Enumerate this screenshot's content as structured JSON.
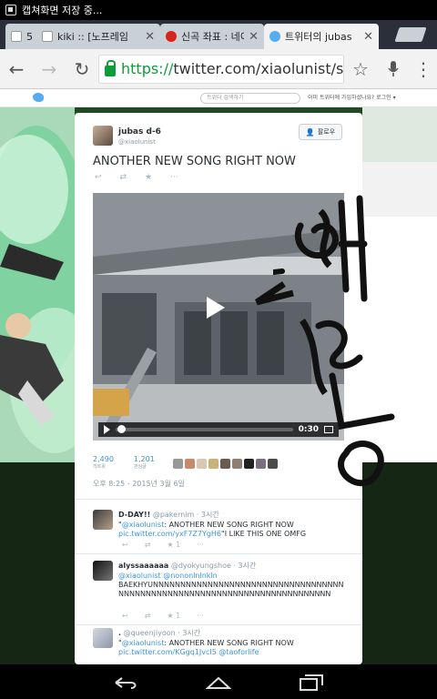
{
  "status": {
    "text": "캡쳐화면 저장 중..."
  },
  "tabs": [
    {
      "title": "5",
      "close": "✕"
    },
    {
      "title": "kiki :: [노프레임",
      "close": "✕"
    },
    {
      "title": "신곡 좌표 : 네이",
      "close": "✕"
    },
    {
      "title": "트위터의 jubas",
      "close": "✕"
    }
  ],
  "toolbar": {
    "back": "←",
    "forward": "→",
    "reload": "↻",
    "url_scheme": "https://",
    "url_rest": "twitter.com/xiaolunist/statu",
    "star": "☆",
    "mic": "🎤",
    "menu": "⋮"
  },
  "twitter_bar": {
    "search_placeholder": "트위터 검색하기",
    "login_text": "이미 트위터에 가입하셨나요? 로그인 ▾"
  },
  "tweet": {
    "name": "jubas d-6",
    "handle": "@xiaolunist",
    "follow": "팔로우",
    "text": "ANOTHER NEW SONG RIGHT NOW",
    "actions": [
      "↩",
      "⇄",
      "★",
      "···"
    ],
    "video": {
      "time": "0:30",
      "progress": 0.02
    },
    "retweets": "2,490",
    "retweets_label": "리트윗",
    "favorites": "1,201",
    "favorites_label": "관심글",
    "date": "오후 8:25 - 2015년 3월 6일"
  },
  "replies": [
    {
      "name": "D-DAY!!",
      "handle": "@pakernim",
      "time": "· 3시간",
      "mention": "@xiaolunist",
      "body": ": ANOTHER NEW SONG RIGHT NOW",
      "link": "pic.twitter.com/yxF7Z7YgH6",
      "tail": "\"I LIKE THIS ONE OMFG",
      "fav_count": "1"
    },
    {
      "name": "alyssaaaaaa",
      "handle": "@dyokyungshoe",
      "time": "· 3시간",
      "mention": "@xiaolunist",
      "link2": "@nononlnlnkln",
      "body": "BAEKHYUNNNNNNNNNNNNNNNNNNNNNNNNNNNNNNNNNNNNNNNNNNNNNNNNNNNNNNNNNNNNNNNNNNNNNNNNNN",
      "fav_count": "1"
    },
    {
      "name": ".",
      "handle": "@queenjiyoon",
      "time": "· 3시간",
      "mention": "@xiaolunist",
      "body": ": ANOTHER NEW SONG RIGHT NOW",
      "link": "pic.twitter.com/KGgq1JvcI5",
      "tail": "@taoforlife"
    }
  ],
  "colors": {
    "twitter_blue": "#55acee",
    "link": "#3b94d9",
    "url_green": "#0a9d38"
  }
}
